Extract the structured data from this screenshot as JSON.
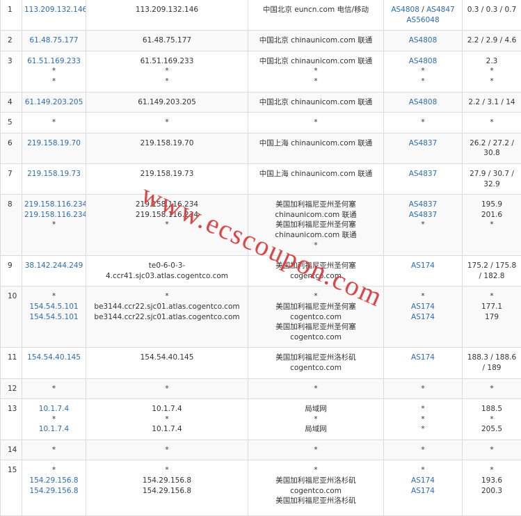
{
  "watermark": "www.ecscoupon.com",
  "rows": [
    {
      "no": "1",
      "ips": [
        "113.209.132.146"
      ],
      "hosts": [
        "113.209.132.146"
      ],
      "locs": [
        "中国北京 euncn.com 电信/移动"
      ],
      "as": [
        [
          "AS4808",
          "AS4847"
        ],
        [
          "AS56048"
        ]
      ],
      "rtt": [
        "0.3 / 0.3 / 0.7"
      ],
      "h": 33
    },
    {
      "no": "2",
      "ips": [
        "61.48.75.177"
      ],
      "hosts": [
        "61.48.75.177"
      ],
      "locs": [
        "中国北京 chinaunicom.com 联通"
      ],
      "as": [
        [
          "AS4808"
        ]
      ],
      "rtt": [
        "2.2 / 2.9 / 4.6"
      ],
      "h": 29
    },
    {
      "no": "3",
      "ips": [
        "61.51.169.233",
        "*",
        "*"
      ],
      "hosts": [
        "61.51.169.233",
        "*",
        "*"
      ],
      "locs": [
        "中国北京 chinaunicom.com 联通",
        "*",
        "*"
      ],
      "as": [
        [
          "AS4808"
        ],
        [
          "*"
        ],
        [
          "*"
        ]
      ],
      "rtt": [
        "2.3",
        "*",
        "*"
      ],
      "h": 58
    },
    {
      "no": "4",
      "ips": [
        "61.149.203.205"
      ],
      "hosts": [
        "61.149.203.205"
      ],
      "locs": [
        "中国北京 chinaunicom.com 联通"
      ],
      "as": [
        [
          "AS4808"
        ]
      ],
      "rtt": [
        "2.2 / 3.1 / 14"
      ],
      "h": 29
    },
    {
      "no": "5",
      "ips": [
        "*"
      ],
      "hosts": [
        "*"
      ],
      "locs": [
        "*"
      ],
      "as": [
        [
          "*"
        ]
      ],
      "rtt": [
        "*"
      ],
      "h": 28
    },
    {
      "no": "6",
      "ips": [
        "219.158.19.70"
      ],
      "hosts": [
        "219.158.19.70"
      ],
      "locs": [
        "中国上海 chinaunicom.com 联通"
      ],
      "as": [
        [
          "AS4837"
        ]
      ],
      "rtt": [
        "26.2 / 27.2 /",
        "30.8"
      ],
      "h": 43
    },
    {
      "no": "7",
      "ips": [
        "219.158.19.73"
      ],
      "hosts": [
        "219.158.19.73"
      ],
      "locs": [
        "中国上海 chinaunicom.com 联通"
      ],
      "as": [
        [
          "AS4837"
        ]
      ],
      "rtt": [
        "27.9 / 30.7 /",
        "32.9"
      ],
      "h": 43
    },
    {
      "no": "8",
      "ips": [
        "219.158.116.234",
        "219.158.116.234",
        "*"
      ],
      "hosts": [
        "219.158.116.234",
        "219.158.116.234",
        "*"
      ],
      "locs": [
        "美国加利福尼亚州圣何塞",
        "chinaunicom.com 联通",
        "美国加利福尼亚州圣何塞",
        "chinaunicom.com 联通",
        "*"
      ],
      "as": [
        [
          "AS4837"
        ],
        [
          "AS4837"
        ],
        [
          "*"
        ]
      ],
      "rtt": [
        "195.9",
        "201.6",
        "*"
      ],
      "h": 88
    },
    {
      "no": "9",
      "ips": [
        "38.142.244.249"
      ],
      "hosts": [
        "te0-6-0-3-",
        "4.ccr41.sjc03.atlas.cogentco.com"
      ],
      "locs": [
        "美国加利福尼亚州圣何塞",
        "cogentco.com"
      ],
      "as": [
        [
          "AS174"
        ]
      ],
      "rtt": [
        "175.2 / 175.8",
        "/ 182.8"
      ],
      "h": 43
    },
    {
      "no": "10",
      "ips": [
        "*",
        "154.54.5.101",
        "154.54.5.101"
      ],
      "hosts": [
        "*",
        "be3144.ccr22.sjc01.atlas.cogentco.com",
        "be3144.ccr22.sjc01.atlas.cogentco.com"
      ],
      "locs": [
        "*",
        "美国加利福尼亚州圣何塞",
        "cogentco.com",
        "美国加利福尼亚州圣何塞",
        "cogentco.com"
      ],
      "as": [
        [
          "*"
        ],
        [
          "AS174"
        ],
        [
          "AS174"
        ]
      ],
      "rtt": [
        "*",
        "177.1",
        "179"
      ],
      "h": 88
    },
    {
      "no": "11",
      "ips": [
        "154.54.40.145"
      ],
      "hosts": [
        "154.54.40.145"
      ],
      "locs": [
        "美国加利福尼亚州洛杉矶",
        "cogentco.com"
      ],
      "as": [
        [
          "AS174"
        ]
      ],
      "rtt": [
        "188.3 / 188.6",
        "/ 189"
      ],
      "h": 43
    },
    {
      "no": "12",
      "ips": [
        "*"
      ],
      "hosts": [
        "*"
      ],
      "locs": [
        "*"
      ],
      "as": [
        [
          "*"
        ]
      ],
      "rtt": [
        "*"
      ],
      "h": 28
    },
    {
      "no": "13",
      "ips": [
        "10.1.7.4",
        "*",
        "10.1.7.4"
      ],
      "hosts": [
        "10.1.7.4",
        "*",
        "10.1.7.4"
      ],
      "locs": [
        "局域网",
        "*",
        "局域网"
      ],
      "as": [
        [
          "*"
        ],
        [
          "*"
        ],
        [
          "*"
        ]
      ],
      "rtt": [
        "188.5",
        "*",
        "205.5"
      ],
      "h": 58
    },
    {
      "no": "14",
      "ips": [
        "*"
      ],
      "hosts": [
        "*"
      ],
      "locs": [
        "*"
      ],
      "as": [
        [
          "*"
        ]
      ],
      "rtt": [
        "*"
      ],
      "h": 28
    },
    {
      "no": "15",
      "ips": [
        "*",
        "154.29.156.8",
        "154.29.156.8"
      ],
      "hosts": [
        "*",
        "154.29.156.8",
        "154.29.156.8"
      ],
      "locs": [
        "*",
        "美国加利福尼亚州洛杉矶",
        "cogentco.com",
        "美国加利福尼亚州洛杉矶"
      ],
      "as": [
        [
          "*"
        ],
        [
          "AS174"
        ],
        [
          "AS174"
        ]
      ],
      "rtt": [
        "*",
        "193.6",
        "200.3"
      ],
      "h": 80
    }
  ]
}
